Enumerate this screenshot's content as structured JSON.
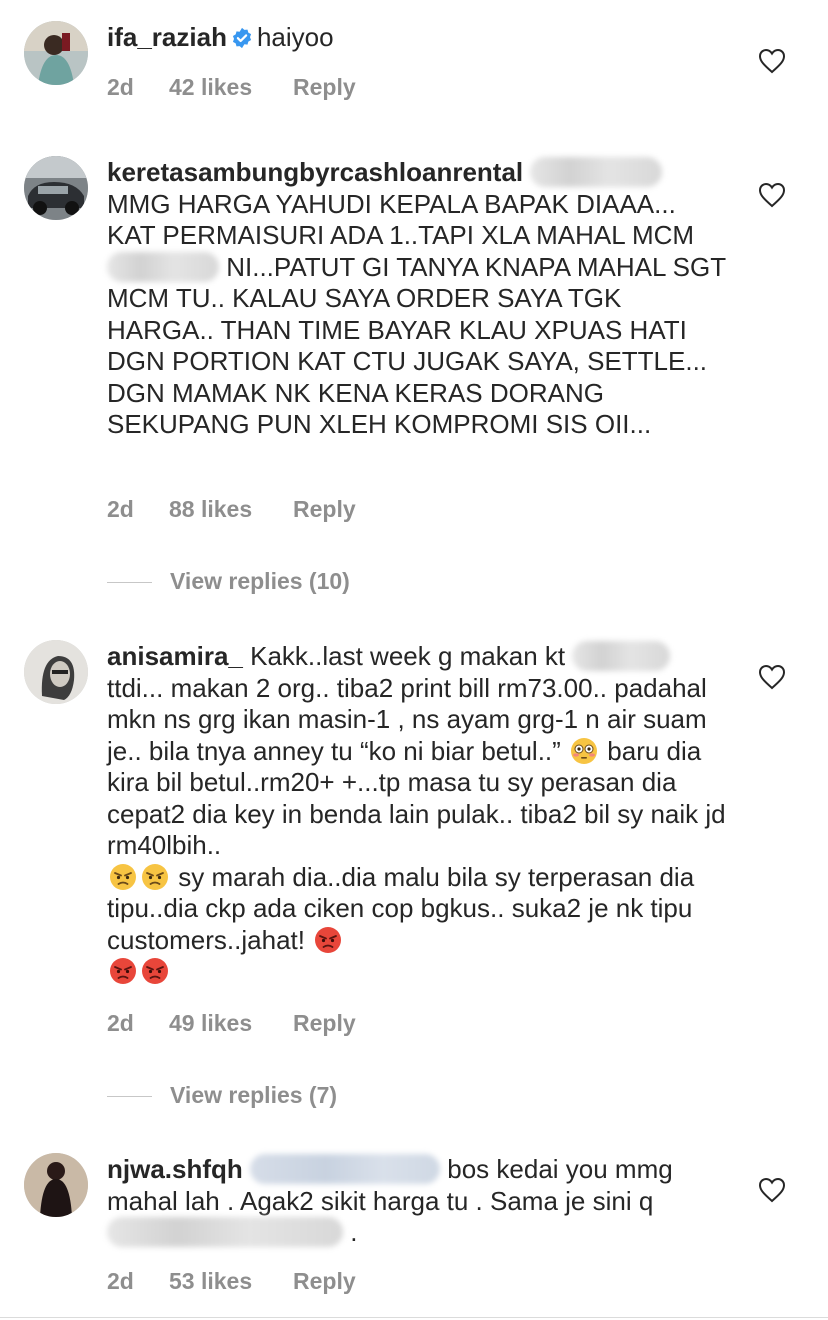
{
  "comments": [
    {
      "username": "ifa_raziah",
      "verified": true,
      "text": "haiyoo",
      "time": "2d",
      "likes": "42 likes",
      "reply": "Reply"
    },
    {
      "username": "keretasambungbyrcashloanrental",
      "text_line1": "MMG HARGA YAHUDI KEPALA BAPAK DIAAA... KAT PERMAISURI ADA 1..TAPI XLA MAHAL MCM",
      "text_line2": "NI...PATUT GI TANYA KNAPA MAHAL SGT MCM TU.. KALAU SAYA ORDER SAYA TGK HARGA.. THAN TIME BAYAR KLAU XPUAS HATI DGN PORTION KAT CTU JUGAK SAYA, SETTLE... DGN MAMAK NK KENA KERAS DORANG SEKUPANG PUN XLEH KOMPROMI SIS OII...",
      "time": "2d",
      "likes": "88 likes",
      "reply": "Reply",
      "view_replies": "View replies (10)"
    },
    {
      "username": "anisamira_",
      "text_a": "Kakk..last week g makan kt",
      "text_b": "ttdi... makan 2 org.. tiba2 print bill rm73.00.. padahal mkn ns grg ikan masin-1 , ns ayam grg-1 n air suam je.. bila tnya anney tu “ko ni biar betul..”",
      "text_c": "baru dia kira bil betul..rm20+ +...tp masa tu sy perasan dia cepat2 dia key in benda lain pulak.. tiba2 bil sy naik jd rm40lbih..",
      "text_d": "sy marah dia..dia malu bila sy terperasan dia tipu..dia ckp ada ciken cop bgkus.. suka2 je nk tipu customers..jahat!",
      "time": "2d",
      "likes": "49 likes",
      "reply": "Reply",
      "view_replies": "View replies (7)"
    },
    {
      "username": "njwa.shfqh",
      "text_a": "bos kedai you mmg mahal lah . Agak2 sikit harga tu . Sama je sini q",
      "text_b": ".",
      "time": "2d",
      "likes": "53 likes",
      "reply": "Reply"
    }
  ],
  "icons": {
    "like": "heart-outline-icon",
    "verified": "verified-badge-icon",
    "emoji_flushed": "flushed-face-emoji",
    "emoji_angry": "angry-face-emoji",
    "emoji_pouting": "pouting-face-emoji"
  },
  "colors": {
    "text": "#262626",
    "meta": "#8e8e8e",
    "verified": "#3897f0"
  }
}
